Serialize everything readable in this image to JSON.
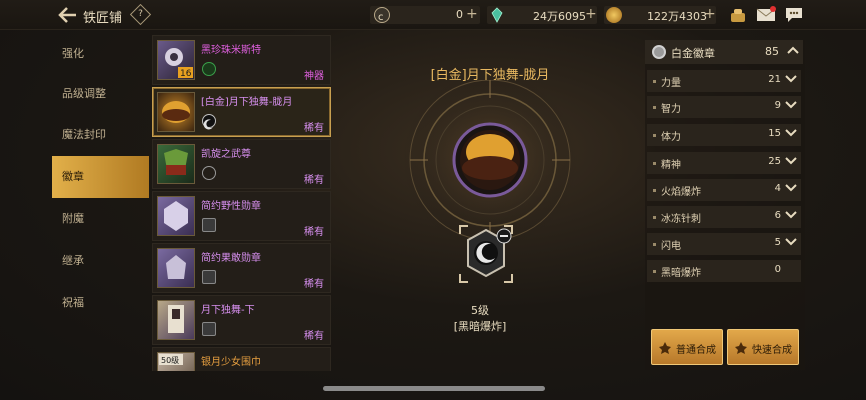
{
  "header": {
    "title": "铁匠铺",
    "help_label": "?",
    "currencies": [
      {
        "icon": "c-coin-icon",
        "value": "0"
      },
      {
        "icon": "green-crystal-icon",
        "value": "24万6095"
      },
      {
        "icon": "gold-coin-icon",
        "value": "122万4303"
      }
    ]
  },
  "menu": {
    "items": [
      {
        "label": "强化"
      },
      {
        "label": "品级调整"
      },
      {
        "label": "魔法封印"
      },
      {
        "label": "徽章"
      },
      {
        "label": "附魔"
      },
      {
        "label": "继承"
      },
      {
        "label": "祝福"
      }
    ],
    "active_index": 3
  },
  "items": [
    {
      "name": "黑珍珠米斯特",
      "rarity": "神器",
      "name_color": "#e060e0",
      "rarity_color": "#e060e0",
      "badge": "16"
    },
    {
      "name": "[白金]月下独舞-胧月",
      "rarity": "稀有",
      "name_color": "#d890f0",
      "rarity_color": "#d890f0",
      "badge": ""
    },
    {
      "name": "凯旋之武尊",
      "rarity": "稀有",
      "name_color": "#d890f0",
      "rarity_color": "#d890f0",
      "badge": ""
    },
    {
      "name": "简约野性勋章",
      "rarity": "稀有",
      "name_color": "#d890f0",
      "rarity_color": "#d890f0",
      "badge": ""
    },
    {
      "name": "简约果敢勋章",
      "rarity": "稀有",
      "name_color": "#d890f0",
      "rarity_color": "#d890f0",
      "badge": ""
    },
    {
      "name": "月下独舞-下",
      "rarity": "稀有",
      "name_color": "#d890f0",
      "rarity_color": "#d890f0",
      "badge": ""
    },
    {
      "name": "银月少女围巾",
      "rarity": "",
      "name_color": "#e8a040",
      "rarity_color": "#e8a040",
      "badge": "50级"
    }
  ],
  "selected": {
    "title": "[白金]月下独舞-胧月",
    "level": "5级",
    "type": "[黑暗爆炸]"
  },
  "stats": {
    "header_label": "白金徽章",
    "header_value": "85",
    "rows": [
      {
        "label": "力量",
        "value": "21"
      },
      {
        "label": "智力",
        "value": "9"
      },
      {
        "label": "体力",
        "value": "15"
      },
      {
        "label": "精神",
        "value": "25"
      },
      {
        "label": "火焰爆炸",
        "value": "4"
      },
      {
        "label": "冰冻针刺",
        "value": "6"
      },
      {
        "label": "闪电",
        "value": "5"
      },
      {
        "label": "黑暗爆炸",
        "value": "0"
      }
    ]
  },
  "buttons": {
    "normal_synthesis": "普通合成",
    "quick_synthesis": "快速合成"
  },
  "colors": {
    "accent_gold": "#e2b04a",
    "title_orange": "#e8b860",
    "epic_purple": "#d890f0"
  }
}
